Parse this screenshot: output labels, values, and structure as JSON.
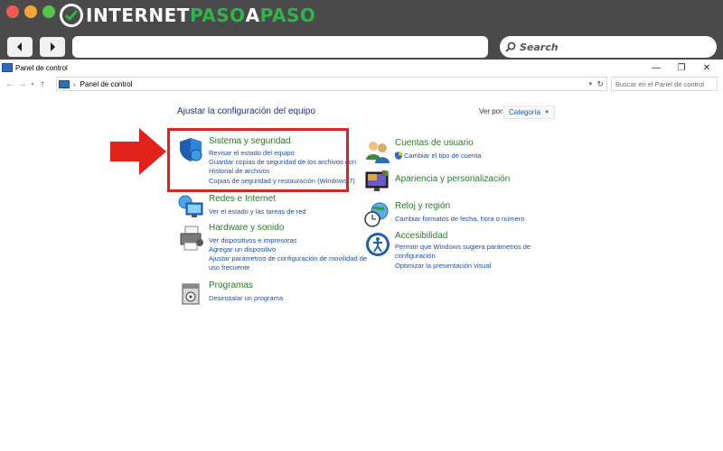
{
  "site_logo": {
    "prefix": "INTERNET",
    "middle": "PASO",
    "a": "A",
    "suffix": "PASO"
  },
  "browser": {
    "search_placeholder": "Search"
  },
  "window": {
    "title": "Panel de control",
    "controls": {
      "minimize": "—",
      "maximize": "❐",
      "close": "✕"
    }
  },
  "address": {
    "path": "Panel de control",
    "search_placeholder": "Buscar en el Panel de control"
  },
  "content": {
    "heading": "Ajustar la configuración del equipo",
    "view_by_label": "Ver por:",
    "view_by_value": "Categoría",
    "left_categories": [
      {
        "title": "Sistema y seguridad",
        "links": [
          "Revisar el estado del equipo",
          "Guardar copias de seguridad de los archivos con",
          "Historial de archivos",
          "Copias de seguridad y restauración (Windows 7)"
        ]
      },
      {
        "title": "Redes e Internet",
        "links": [
          "Ver el estado y las tareas de red"
        ]
      },
      {
        "title": "Hardware y sonido",
        "links": [
          "Ver dispositivos e impresoras",
          "Agregar un dispositivo",
          "Ajustar parámetros de configuración de movilidad de",
          "uso frecuente"
        ]
      },
      {
        "title": "Programas",
        "links": [
          "Desinstalar un programa"
        ]
      }
    ],
    "right_categories": [
      {
        "title": "Cuentas de usuario",
        "links": [
          "Cambiar el tipo de cuenta"
        ]
      },
      {
        "title": "Apariencia y personalización",
        "links": []
      },
      {
        "title": "Reloj y región",
        "links": [
          "Cambiar formatos de fecha, hora o número"
        ]
      },
      {
        "title": "Accesibilidad",
        "links": [
          "Permitir que Windows sugiera parámetros de",
          "configuración",
          "Optimizar la presentación visual"
        ]
      }
    ]
  },
  "colors": {
    "chrome_bg": "#4a4a4a",
    "category_title": "#2b7a2b",
    "link": "#1e4fa8",
    "heading": "#1e3287",
    "highlight": "#e1231b"
  }
}
